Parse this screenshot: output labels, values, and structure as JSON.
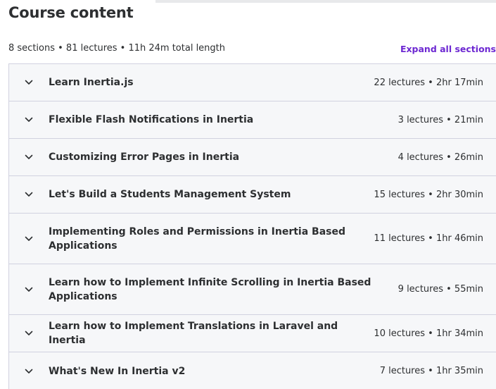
{
  "header": {
    "title": "Course content",
    "summary": "8 sections • 81 lectures • 11h 24m total length",
    "expand_all_label": "Expand all sections"
  },
  "icons": {
    "chevron": "chevron-down-icon"
  },
  "colors": {
    "accent": "#6d28d2",
    "row_background": "#f6f7f9",
    "border": "#d1d2e0",
    "text": "#2d2f31"
  },
  "sections": [
    {
      "title": "Learn Inertia.js",
      "meta": "22 lectures • 2hr 17min"
    },
    {
      "title": "Flexible Flash Notifications in Inertia",
      "meta": "3 lectures • 21min"
    },
    {
      "title": "Customizing Error Pages in Inertia",
      "meta": "4 lectures • 26min"
    },
    {
      "title": "Let's Build a Students Management System",
      "meta": "15 lectures • 2hr 30min"
    },
    {
      "title": "Implementing Roles and Permissions in Inertia Based Applications",
      "meta": "11 lectures • 1hr 46min"
    },
    {
      "title": "Learn how to Implement Infinite Scrolling in Inertia Based Applications",
      "meta": "9 lectures • 55min"
    },
    {
      "title": "Learn how to Implement Translations in Laravel and Inertia",
      "meta": "10 lectures • 1hr 34min"
    },
    {
      "title": "What's New In Inertia v2",
      "meta": "7 lectures • 1hr 35min"
    }
  ]
}
